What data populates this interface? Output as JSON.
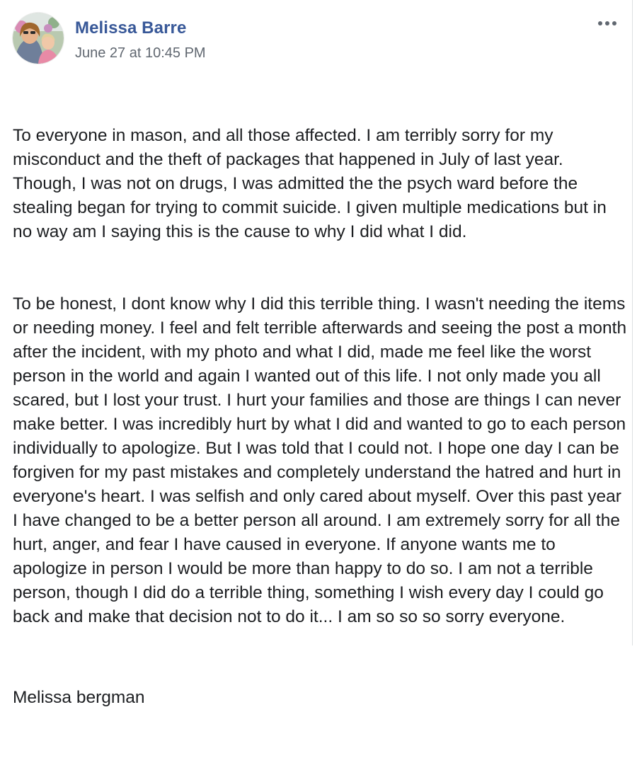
{
  "post": {
    "author": "Melissa Barre",
    "timestamp": "June 27 at 10:45 PM",
    "more_icon": "ellipsis-icon",
    "paragraphs": [
      "To everyone in mason, and all those affected. I am terribly sorry for my misconduct and the theft of packages that happened in July of last year. Though, I was not on drugs, I was admitted the the psych ward before the stealing began for trying to commit suicide. I given multiple medications but in no way am I saying this is the cause to why I did what I did.",
      "To be honest, I dont know why I did this terrible thing. I wasn't needing the items or needing money. I feel and felt terrible afterwards and seeing the post a month after the incident, with my photo and what I did, made me feel like the worst person in the world and again I wanted out of this life. I not only made you all scared, but I lost your trust. I hurt your families and those are things I can never make better. I was incredibly hurt by what I did and wanted to go to each person individually to apologize. But I was told that I could not. I hope one day I can be forgiven for my past mistakes and completely understand the hatred and hurt in everyone's heart. I was selfish and only cared about myself. Over this past year I have changed to be a better person all around. I am extremely sorry for all the hurt, anger, and fear I have caused in everyone. If anyone wants me to apologize in person I would be more than happy to do so. I am not a terrible person, though I did do a terrible thing, something I wish every day I could go back and make that decision not to do it... I am so so so sorry everyone."
    ],
    "signoff": "Melissa bergman"
  },
  "colors": {
    "author_link": "#385898",
    "meta_text": "#606770",
    "body_text": "#1c1e21"
  }
}
